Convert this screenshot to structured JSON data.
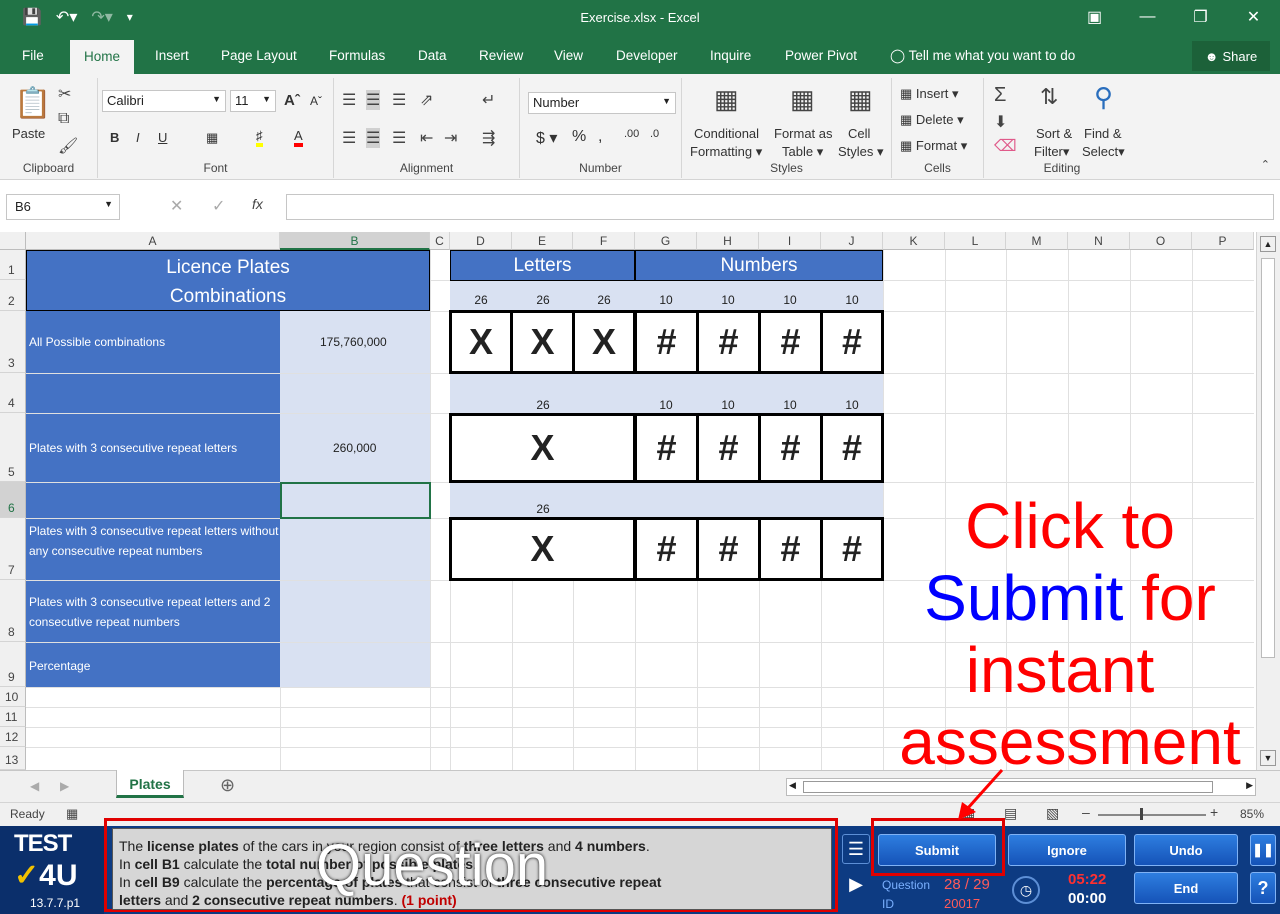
{
  "window": {
    "title": "Exercise.xlsx  -  Excel"
  },
  "tabs": [
    "File",
    "Home",
    "Insert",
    "Page Layout",
    "Formulas",
    "Data",
    "Review",
    "View",
    "Developer",
    "Inquire",
    "Power Pivot"
  ],
  "tell_me": "Tell me what you want to do",
  "share": "Share",
  "ribbon": {
    "paste": "Paste",
    "clipboard": "Clipboard",
    "font_name": "Calibri",
    "font_size": "11",
    "font": "Font",
    "alignment": "Alignment",
    "number_format": "Number",
    "number": "Number",
    "conditional": "Conditional",
    "formatting": "Formatting",
    "format_as": "Format as",
    "table": "Table",
    "cell": "Cell",
    "styles_btn": "Styles",
    "styles": "Styles",
    "insert": "Insert",
    "delete": "Delete",
    "format": "Format",
    "cells": "Cells",
    "sort": "Sort &",
    "filter": "Filter",
    "find": "Find &",
    "select": "Select",
    "editing": "Editing"
  },
  "namebox": "B6",
  "columns": [
    "A",
    "B",
    "C",
    "D",
    "E",
    "F",
    "G",
    "H",
    "I",
    "J",
    "K",
    "L",
    "M",
    "N",
    "O",
    "P"
  ],
  "rows": [
    "1",
    "2",
    "3",
    "4",
    "5",
    "6",
    "7",
    "8",
    "9",
    "10",
    "11",
    "12",
    "13"
  ],
  "sheet": {
    "title1": "Licence Plates",
    "title2": "Combinations",
    "a3": "All Possible combinations",
    "b3": "175,760,000",
    "a5": "Plates with 3 consecutive repeat letters",
    "b5": "260,000",
    "a7": "Plates with 3 consecutive repeat letters without any consecutive repeat numbers",
    "a8": "Plates with 3 consecutive repeat letters and 2 consecutive  repeat numbers",
    "a9": "Percentage",
    "letters": "Letters",
    "numbers": "Numbers",
    "n26": "26",
    "n10": "10",
    "x": "X",
    "hash": "#"
  },
  "sheet_tab": "Plates",
  "status": {
    "ready": "Ready",
    "zoom": "85%"
  },
  "question": {
    "l1a": "The ",
    "l1b": "license plates",
    "l1c": " of the cars in your region consist of ",
    "l1d": "three letters",
    "l1e": " and ",
    "l1f": "4 numbers",
    "l1g": ".",
    "l2a": "In ",
    "l2b": "cell B1",
    "l2c": " calculate the ",
    "l2d": "total number of possible plates",
    "l2e": ".",
    "l3a": "In ",
    "l3b": "cell B9",
    "l3c": " calculate the ",
    "l3d": "percentage of plates",
    "l3e": " that consist of ",
    "l3f": "three consecutive repeat",
    "l4a": "letters",
    "l4b": " and ",
    "l4c": "2 consecutive repeat numbers",
    "l4d": ". ",
    "l4e": "(1 point)"
  },
  "overlay_question": "Question",
  "logo": {
    "test": "TEST",
    "four_u": "4U",
    "version": "13.7.7.p1"
  },
  "buttons": {
    "submit": "Submit",
    "ignore": "Ignore",
    "undo": "Undo",
    "end": "End"
  },
  "info": {
    "question_label": "Question",
    "id_label": "ID",
    "progress": "28 / 29",
    "id": "20017",
    "time1": "05:22",
    "time2": "00:00"
  },
  "annotation": {
    "l1": "Click to",
    "l2a": "Submit",
    "l2b": " for",
    "l3": "instant",
    "l4": "assessment"
  },
  "colors": {
    "excel_green": "#217346",
    "header_blue": "#4472c4",
    "light_blue": "#d9e1f2",
    "panel_blue": "#0d3b82",
    "red": "#ff0000"
  }
}
